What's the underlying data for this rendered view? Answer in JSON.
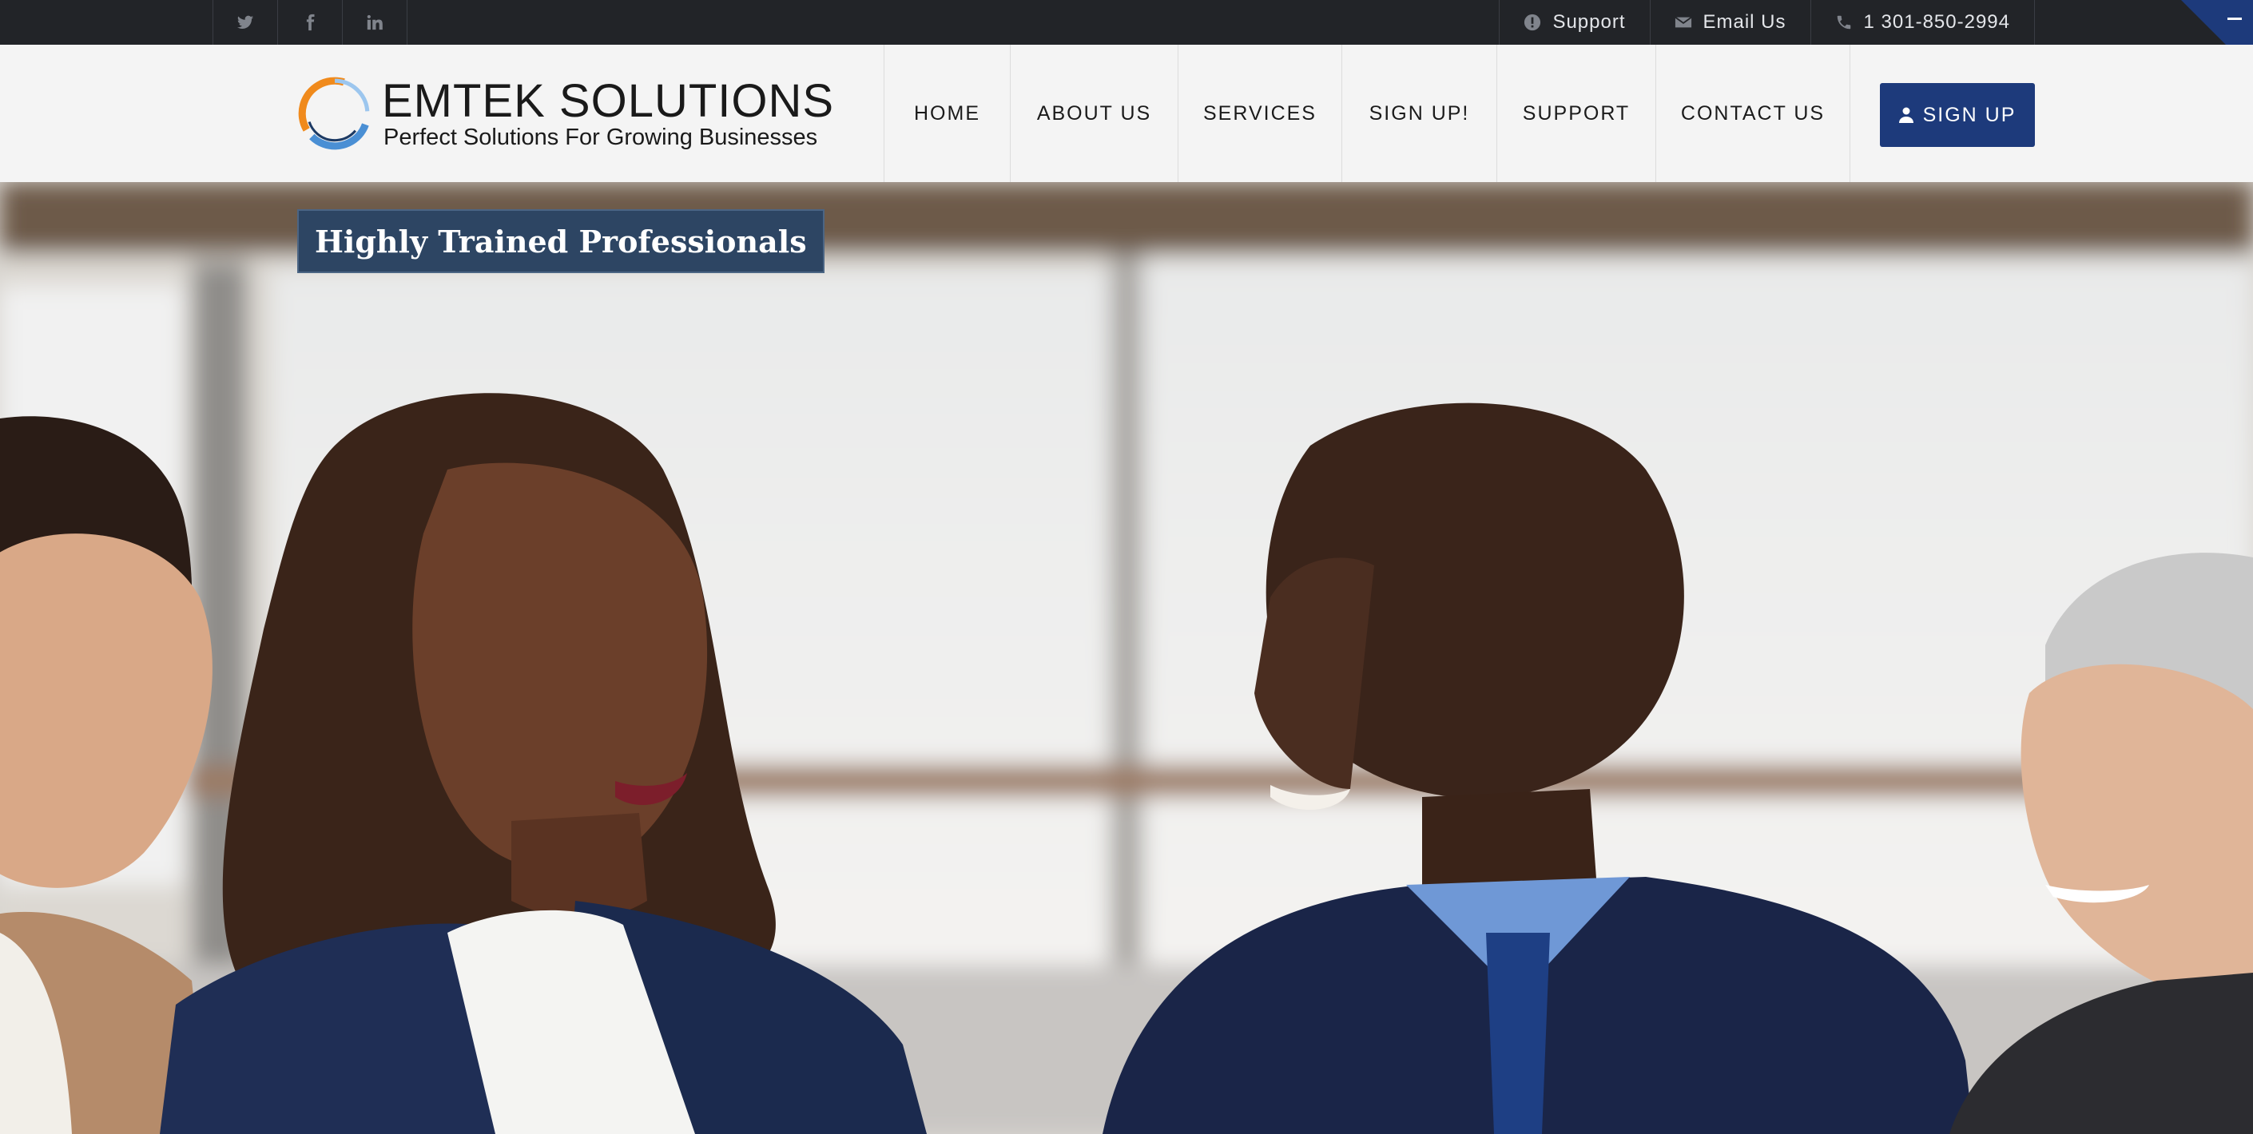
{
  "topbar": {
    "social": [
      {
        "icon": "twitter-icon"
      },
      {
        "icon": "facebook-icon"
      },
      {
        "icon": "linkedin-icon"
      }
    ],
    "contact": {
      "support_label": "Support",
      "email_label": "Email Us",
      "phone_label": "1 301-850-2994"
    },
    "corner_label": "–"
  },
  "header": {
    "logo_title": "EMTEK SOLUTIONS",
    "logo_tagline": "Perfect Solutions For Growing Businesses",
    "nav": [
      "HOME",
      "ABOUT US",
      "SERVICES",
      "SIGN UP!",
      "SUPPORT",
      "CONTACT US"
    ],
    "signup_label": "SIGN UP"
  },
  "hero": {
    "caption": "Highly Trained Professionals"
  },
  "colors": {
    "topbar_bg": "#222428",
    "header_bg": "#f4f4f4",
    "accent_blue": "#1d3a7b",
    "caption_bg": "#2d4563",
    "logo_orange": "#f08a1c",
    "logo_blue": "#4a8fd4"
  }
}
